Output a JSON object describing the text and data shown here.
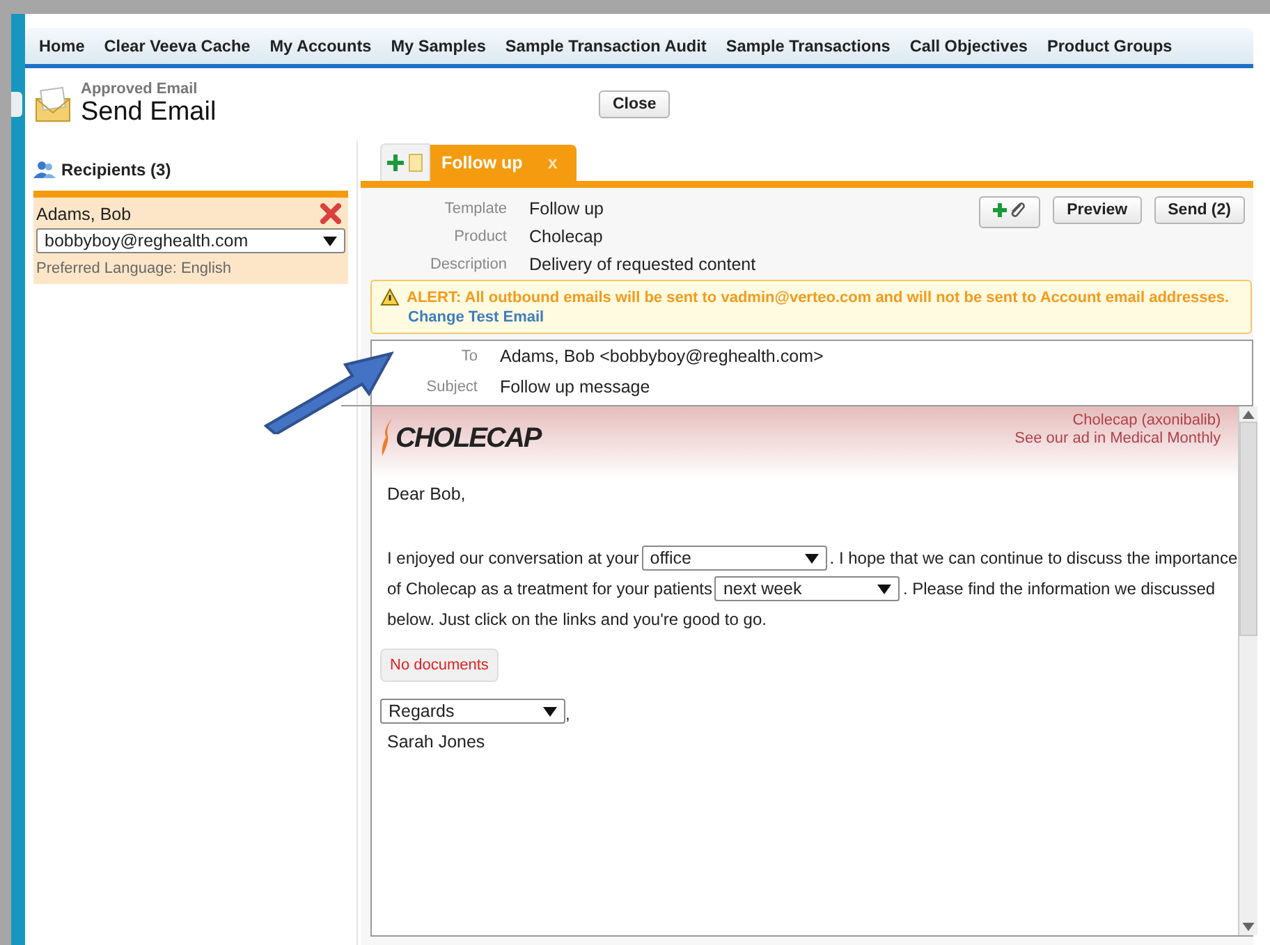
{
  "nav": [
    {
      "label": "Home"
    },
    {
      "label": "Clear Veeva Cache"
    },
    {
      "label": "My Accounts"
    },
    {
      "label": "My Samples"
    },
    {
      "label": "Sample Transaction Audit"
    },
    {
      "label": "Sample Transactions"
    },
    {
      "label": "Call Objectives"
    },
    {
      "label": "Product Groups"
    }
  ],
  "header": {
    "subtitle": "Approved Email",
    "title": "Send Email",
    "close_button": "Close"
  },
  "recipients": {
    "title": "Recipients (3)",
    "items": [
      {
        "name": "Adams, Bob",
        "email": "bobbyboy@reghealth.com",
        "language": "Preferred Language: English",
        "selected": true
      }
    ]
  },
  "tabs": [
    {
      "label": "Follow up",
      "close": "x",
      "selected": true
    }
  ],
  "fields": [
    {
      "label": "Template",
      "value": "Follow up"
    },
    {
      "label": "Product",
      "value": "Cholecap"
    },
    {
      "label": "Description",
      "value": "Delivery of requested content"
    }
  ],
  "buttons": [
    {
      "label": "Preview"
    },
    {
      "label": "Send (2)"
    }
  ],
  "alert": {
    "text": "ALERT: All outbound emails will be sent to vadmin@verteo.com and will not be sent to Account email addresses.",
    "link": "Change Test Email"
  },
  "message": [
    {
      "label": "To",
      "value": "Adams, Bob <bobbyboy@reghealth.com>"
    },
    {
      "label": "Subject",
      "value": "Follow up message"
    }
  ],
  "email_body": {
    "logo": "CHOLECAP",
    "product": "Cholecap (axonibalib)",
    "ad": "See our ad in Medical Monthly",
    "greeting": "Dear Bob,",
    "paragraph": [
      [
        {
          "kind": "text",
          "text": "I enjoyed our conversation at your"
        },
        {
          "kind": "select",
          "value": "office"
        },
        {
          "kind": "text",
          "text": ". I hope that we can continue to discuss the importance"
        }
      ],
      [
        {
          "kind": "text",
          "text": "of Cholecap as a treatment for your patients"
        },
        {
          "kind": "select",
          "value": "next week"
        },
        {
          "kind": "text",
          "text": ". Please find the information we discussed"
        }
      ],
      [
        {
          "kind": "text",
          "text": "below. Just click on the links and you're good to go."
        }
      ]
    ],
    "documents": "No documents",
    "closing": "Regards",
    "closing_suffix": ",",
    "signature": "Sarah Jones"
  }
}
